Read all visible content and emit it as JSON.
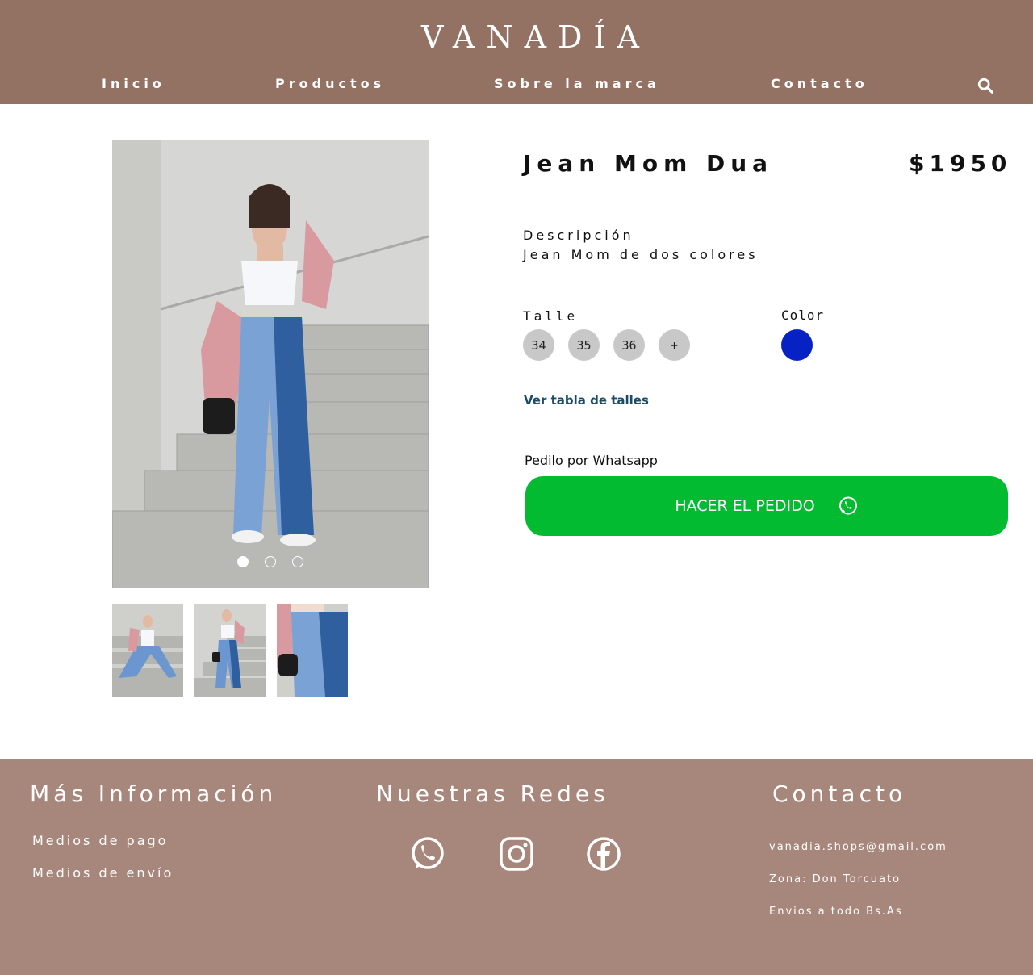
{
  "header": {
    "brand": "VANADÍA",
    "nav": [
      "Inicio",
      "Productos",
      "Sobre la marca",
      "Contacto"
    ],
    "search_icon": "search-icon"
  },
  "product": {
    "title": "Jean Mom Dua",
    "price": "$1950",
    "description_label": "Descripción",
    "description_text": "Jean Mom de dos colores",
    "size_label": "Talle",
    "sizes": [
      "34",
      "35",
      "36",
      "+"
    ],
    "color_label": "Color",
    "colors": [
      "#0622c4"
    ],
    "size_chart_link": "Ver tabla de talles",
    "whatsapp_label": "Pedilo por Whatsapp",
    "order_button": "HACER EL PEDIDO",
    "order_button_color": "#02bb30",
    "carousel_count": 3,
    "carousel_active": 0,
    "thumbnails_count": 3
  },
  "footer": {
    "info_heading": "Más Información",
    "info_links": [
      "Medios de pago",
      "Medios de envío"
    ],
    "social_heading": "Nuestras Redes",
    "social_icons": [
      "whatsapp-icon",
      "instagram-icon",
      "facebook-icon"
    ],
    "contact_heading": "Contacto",
    "contact_lines": [
      "vanadia.shops@gmail.com",
      "Zona: Don Torcuato",
      "Envios a todo Bs.As"
    ]
  },
  "colors": {
    "header_bg": "#937264",
    "footer_bg": "#a7877b",
    "link": "#1b4b66"
  }
}
